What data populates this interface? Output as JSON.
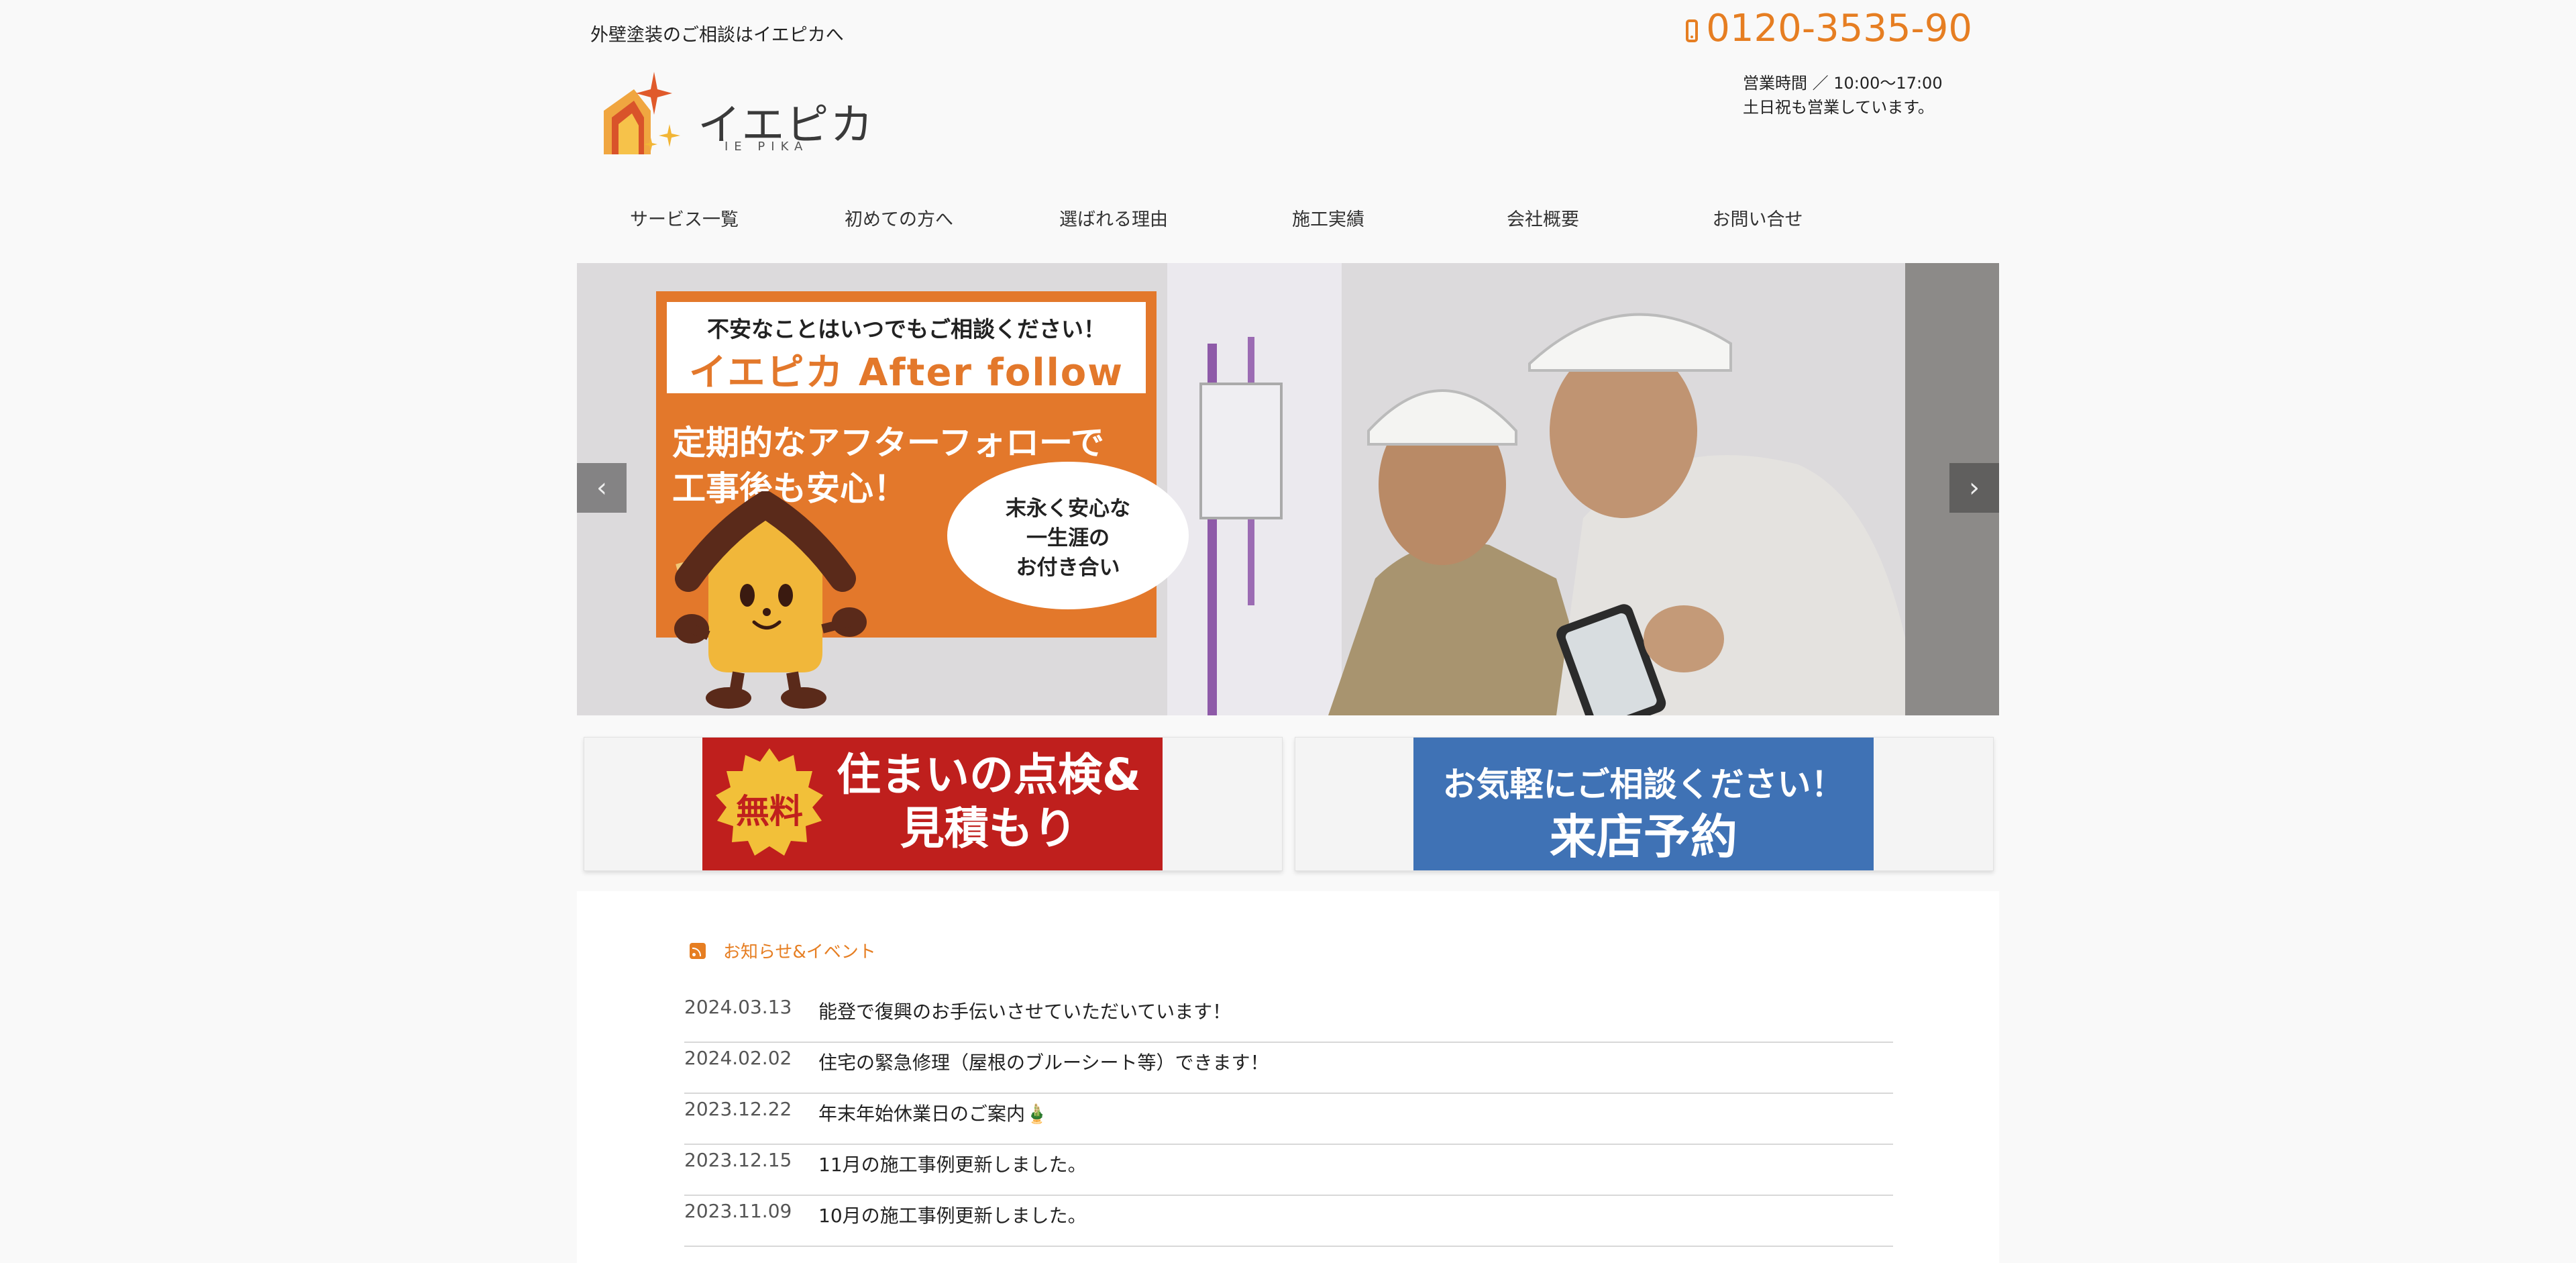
{
  "header": {
    "tagline": "外壁塗装のご相談はイエピカへ",
    "logo_text": "イエピカ",
    "logo_sub": "IE PIKA",
    "phone": "0120-3535-90",
    "hours_line1": "営業時間 ／ 10:00〜17:00",
    "hours_line2": "土日祝も営業しています。"
  },
  "nav": {
    "items": [
      {
        "label": "サービス一覧"
      },
      {
        "label": "初めての方へ"
      },
      {
        "label": "選ばれる理由"
      },
      {
        "label": "施工実績"
      },
      {
        "label": "会社概要"
      },
      {
        "label": "お問い合せ"
      }
    ]
  },
  "hero": {
    "promo_line1": "不安なことはいつでもご相談ください！",
    "promo_line2": "イエピカ After follow",
    "promo_main_1": "定期的なアフターフォローで",
    "promo_main_2": "工事後も安心！",
    "bubble_1": "末永く安心な",
    "bubble_2": "一生涯の",
    "bubble_3": "お付き合い",
    "prev_arrow": "‹",
    "next_arrow": "›"
  },
  "banners": {
    "free_badge": "無料",
    "inspection_line1": "住まいの点検&",
    "inspection_line2": "見積もり",
    "consult_line1": "お気軽にご相談ください！",
    "consult_line2": "来店予約"
  },
  "news": {
    "heading": "お知らせ&イベント",
    "items": [
      {
        "date": "2024.03.13",
        "title": "能登で復興のお手伝いさせていただいています！"
      },
      {
        "date": "2024.02.02",
        "title": "住宅の緊急修理（屋根のブルーシート等）できます！"
      },
      {
        "date": "2023.12.22",
        "title": "年末年始休業日のご案内🎍"
      },
      {
        "date": "2023.12.15",
        "title": "11月の施工事例更新しました。"
      },
      {
        "date": "2023.11.09",
        "title": "10月の施工事例更新しました。"
      }
    ]
  },
  "colors": {
    "accent_orange": "#e67e22",
    "promo_orange": "#e3782b",
    "banner_red": "#bf1f1d",
    "banner_blue": "#3f72b5"
  }
}
